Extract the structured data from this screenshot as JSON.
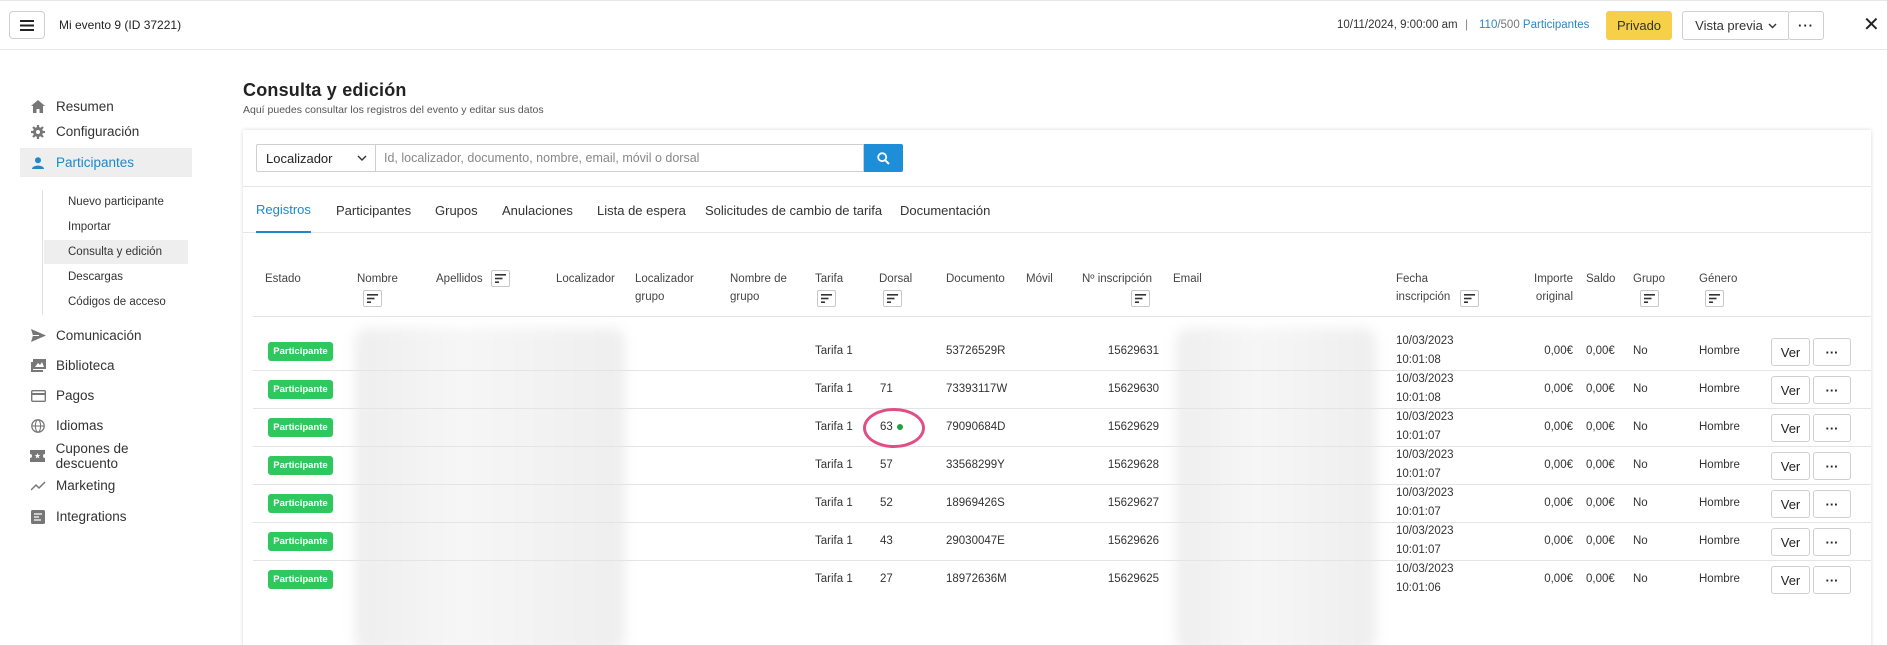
{
  "header": {
    "event_title": "Mi evento 9 (ID 37221)",
    "date": "10/11/2024, 9:00:00 am",
    "separator": "|",
    "count_current": "110",
    "count_total": "/500",
    "count_label": " Participantes",
    "privado_label": "Privado",
    "vista_previa_label": "Vista previa",
    "more_label": "···",
    "close_label": "✕"
  },
  "sidebar": {
    "items": [
      {
        "label": "Resumen",
        "icon": "home-icon"
      },
      {
        "label": "Configuración",
        "icon": "gear-icon"
      },
      {
        "label": "Participantes",
        "icon": "person-icon"
      },
      {
        "label": "Comunicación",
        "icon": "send-icon"
      },
      {
        "label": "Biblioteca",
        "icon": "gallery-icon"
      },
      {
        "label": "Pagos",
        "icon": "card-icon"
      },
      {
        "label": "Idiomas",
        "icon": "globe-icon"
      },
      {
        "label": "Cupones de descuento",
        "icon": "ticket-icon"
      },
      {
        "label": "Marketing",
        "icon": "trend-icon"
      },
      {
        "label": "Integrations",
        "icon": "integrations-icon"
      }
    ],
    "sub_items": [
      "Nuevo participante",
      "Importar",
      "Consulta y edición",
      "Descargas",
      "Códigos de acceso"
    ]
  },
  "main": {
    "title": "Consulta y edición",
    "subtitle": "Aquí puedes consultar los registros del evento y editar sus datos",
    "search": {
      "select_value": "Localizador",
      "placeholder": "Id, localizador, documento, nombre, email, móvil o dorsal"
    },
    "tabs": [
      "Registros",
      "Participantes",
      "Grupos",
      "Anulaciones",
      "Lista de espera",
      "Solicitudes de cambio de tarifa",
      "Documentación"
    ]
  },
  "table": {
    "headers": {
      "estado": "Estado",
      "nombre": "Nombre",
      "apellidos": "Apellidos",
      "localizador": "Localizador",
      "localizador_grupo_1": "Localizador",
      "localizador_grupo_2": "grupo",
      "nombre_grupo_1": "Nombre de",
      "nombre_grupo_2": "grupo",
      "tarifa": "Tarifa",
      "dorsal": "Dorsal",
      "documento": "Documento",
      "movil": "Móvil",
      "n_inscripcion": "Nº inscripción",
      "email": "Email",
      "fecha_1": "Fecha",
      "fecha_2": "inscripción",
      "importe_1": "Importe",
      "importe_2": "original",
      "saldo": "Saldo",
      "grupo": "Grupo",
      "genero": "Género"
    },
    "rows": [
      {
        "estado": "Participante",
        "tarifa": "Tarifa 1",
        "dorsal": "",
        "documento": "53726529R",
        "n_inscripcion": "15629631",
        "fecha": "10/03/2023",
        "hora": "10:01:08",
        "importe": "0,00€",
        "saldo": "0,00€",
        "grupo": "No",
        "genero": "Hombre",
        "ver": "Ver",
        "more": "···"
      },
      {
        "estado": "Participante",
        "tarifa": "Tarifa 1",
        "dorsal": "71",
        "documento": "73393117W",
        "n_inscripcion": "15629630",
        "fecha": "10/03/2023",
        "hora": "10:01:08",
        "importe": "0,00€",
        "saldo": "0,00€",
        "grupo": "No",
        "genero": "Hombre",
        "ver": "Ver",
        "more": "···"
      },
      {
        "estado": "Participante",
        "tarifa": "Tarifa 1",
        "dorsal": "63",
        "documento": "79090684D",
        "n_inscripcion": "15629629",
        "fecha": "10/03/2023",
        "hora": "10:01:07",
        "importe": "0,00€",
        "saldo": "0,00€",
        "grupo": "No",
        "genero": "Hombre",
        "ver": "Ver",
        "more": "···"
      },
      {
        "estado": "Participante",
        "tarifa": "Tarifa 1",
        "dorsal": "57",
        "documento": "33568299Y",
        "n_inscripcion": "15629628",
        "fecha": "10/03/2023",
        "hora": "10:01:07",
        "importe": "0,00€",
        "saldo": "0,00€",
        "grupo": "No",
        "genero": "Hombre",
        "ver": "Ver",
        "more": "···"
      },
      {
        "estado": "Participante",
        "tarifa": "Tarifa 1",
        "dorsal": "52",
        "documento": "18969426S",
        "n_inscripcion": "15629627",
        "fecha": "10/03/2023",
        "hora": "10:01:07",
        "importe": "0,00€",
        "saldo": "0,00€",
        "grupo": "No",
        "genero": "Hombre",
        "ver": "Ver",
        "more": "···"
      },
      {
        "estado": "Participante",
        "tarifa": "Tarifa 1",
        "dorsal": "43",
        "documento": "29030047E",
        "n_inscripcion": "15629626",
        "fecha": "10/03/2023",
        "hora": "10:01:07",
        "importe": "0,00€",
        "saldo": "0,00€",
        "grupo": "No",
        "genero": "Hombre",
        "ver": "Ver",
        "more": "···"
      },
      {
        "estado": "Participante",
        "tarifa": "Tarifa 1",
        "dorsal": "27",
        "documento": "18972636M",
        "n_inscripcion": "15629625",
        "fecha": "10/03/2023",
        "hora": "10:01:06",
        "importe": "0,00€",
        "saldo": "0,00€",
        "grupo": "No",
        "genero": "Hombre",
        "ver": "Ver",
        "more": "···"
      }
    ]
  },
  "colors": {
    "accent": "#1e88c9",
    "badge_green": "#2ec85e",
    "privado_yellow": "#f7d04a",
    "highlight_pink": "#e04e86"
  }
}
